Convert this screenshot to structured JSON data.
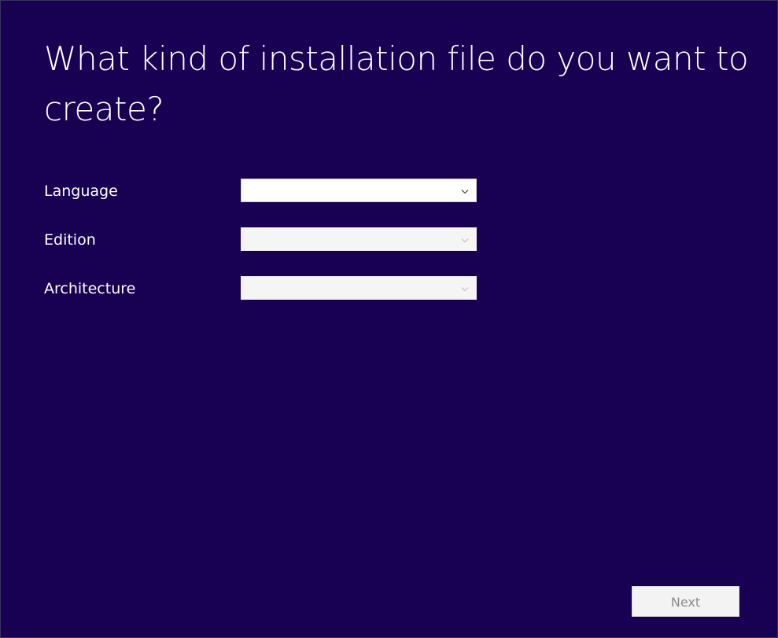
{
  "page": {
    "title": "What kind of installation file do you want to create?"
  },
  "form": {
    "fields": [
      {
        "label": "Language",
        "value": "",
        "icon": "chevron-down-icon",
        "enabled": true
      },
      {
        "label": "Edition",
        "value": "",
        "icon": "chevron-down-icon",
        "enabled": false
      },
      {
        "label": "Architecture",
        "value": "",
        "icon": "chevron-down-icon",
        "enabled": false
      }
    ]
  },
  "actions": {
    "next_label": "Next",
    "next_enabled": false
  },
  "colors": {
    "background": "#180052",
    "text": "#ffffff",
    "select_enabled": "#ffffff",
    "select_disabled": "#f5f5f5",
    "chevron_enabled": "#555555",
    "chevron_disabled": "#c7c7c7",
    "button_disabled_bg": "#f3f3f3",
    "button_disabled_text": "#8b8b8b"
  }
}
